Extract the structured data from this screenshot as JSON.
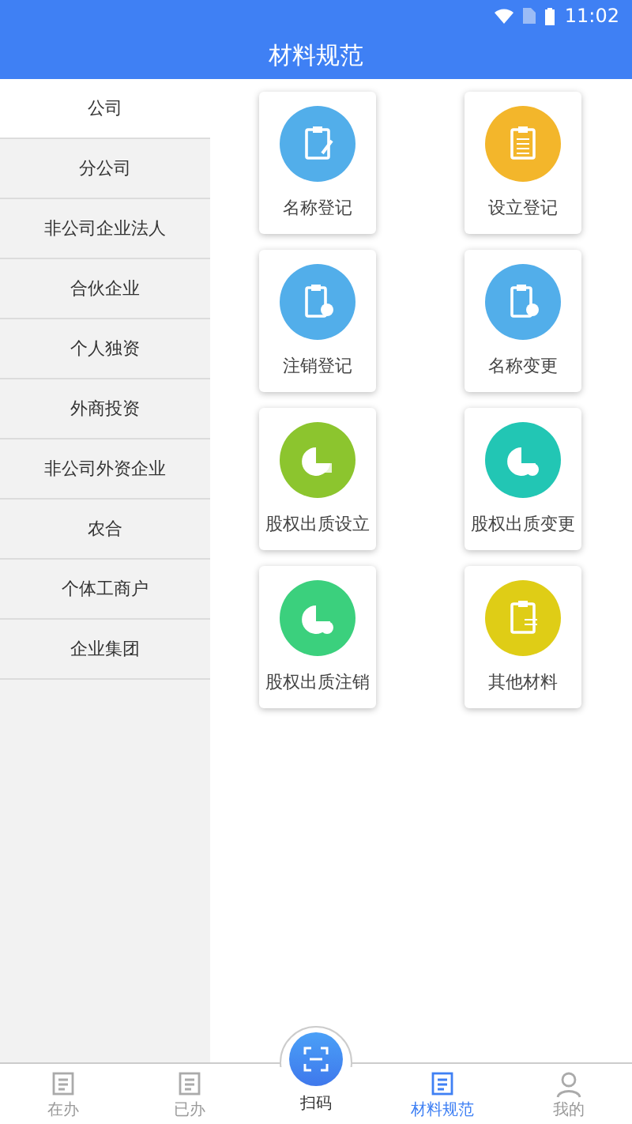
{
  "status_bar": {
    "time": "11:02"
  },
  "header": {
    "title": "材料规范"
  },
  "sidebar": {
    "items": [
      {
        "label": "公司",
        "selected": true
      },
      {
        "label": "分公司",
        "selected": false
      },
      {
        "label": "非公司企业法人",
        "selected": false
      },
      {
        "label": "合伙企业",
        "selected": false
      },
      {
        "label": "个人独资",
        "selected": false
      },
      {
        "label": "外商投资",
        "selected": false
      },
      {
        "label": "非公司外资企业",
        "selected": false
      },
      {
        "label": "农合",
        "selected": false
      },
      {
        "label": "个体工商户",
        "selected": false
      },
      {
        "label": "企业集团",
        "selected": false
      }
    ]
  },
  "materials": [
    {
      "label": "名称登记",
      "color": "#52aeea"
    },
    {
      "label": "设立登记",
      "color": "#f3b62b"
    },
    {
      "label": "注销登记",
      "color": "#52aeea"
    },
    {
      "label": "名称变更",
      "color": "#52aeea"
    },
    {
      "label": "股权出质设立",
      "color": "#8cc52e"
    },
    {
      "label": "股权出质变更",
      "color": "#22c6b4"
    },
    {
      "label": "股权出质注销",
      "color": "#3bd07d"
    },
    {
      "label": "其他材料",
      "color": "#dfcd16"
    }
  ],
  "bottom_nav": [
    {
      "kind": "tab",
      "label": "在办",
      "selected": false
    },
    {
      "kind": "tab",
      "label": "已办",
      "selected": false
    },
    {
      "kind": "scan",
      "label": "扫码"
    },
    {
      "kind": "tab",
      "label": "材料规范",
      "selected": true
    },
    {
      "kind": "tab",
      "label": "我的",
      "selected": false
    }
  ]
}
